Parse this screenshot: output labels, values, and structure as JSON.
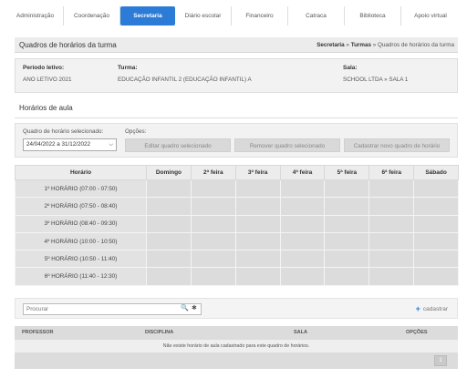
{
  "nav": {
    "items": [
      {
        "label": "Administração",
        "active": false
      },
      {
        "label": "Coordenação",
        "active": false
      },
      {
        "label": "Secretaria",
        "active": true
      },
      {
        "label": "Diário escolar",
        "active": false
      },
      {
        "label": "Financeiro",
        "active": false
      },
      {
        "label": "Catraca",
        "active": false
      },
      {
        "label": "Biblioteca",
        "active": false
      },
      {
        "label": "Apoio virtual",
        "active": false
      }
    ]
  },
  "header": {
    "title": "Quadros de horários da turma",
    "breadcrumb": {
      "secretaria": "Secretaria",
      "sep1": " » ",
      "turmas": "Turmas",
      "sep2": " » ",
      "current": "Quadros de horários da turma"
    }
  },
  "info": {
    "periodo_label": "Período letivo:",
    "periodo_value": "ANO LETIVO 2021",
    "turma_label": "Turma:",
    "turma_value": "EDUCAÇÃO INFANTIL 2 (EDUCAÇÃO INFANTIL) A",
    "sala_label": "Sala:",
    "sala_value": "SCHOOL LTDA » SALA 1"
  },
  "section": {
    "title": "Horários de aula"
  },
  "selector": {
    "label": "Quadro de horário selecionado:",
    "value": "24/04/2022 a 31/12/2022",
    "opcoes_label": "Opções:",
    "btn_edit": "Editar quadro selecionado",
    "btn_remove": "Remover quadro selecionado",
    "btn_new": "Cadastrar novo quadro de horário"
  },
  "grid": {
    "headers": [
      "Horário",
      "Domingo",
      "2ª feira",
      "3ª feira",
      "4ª feira",
      "5ª feira",
      "6ª feira",
      "Sábado"
    ],
    "rows": [
      "1º HORÁRIO (07:00 - 07:50)",
      "2º HORÁRIO (07:50 - 08:40)",
      "3º HORÁRIO (08:40 - 09:30)",
      "4º HORÁRIO (10:00 - 10:50)",
      "5º HORÁRIO (10:50 - 11:40)",
      "6º HORÁRIO (11:40 - 12:30)"
    ]
  },
  "search": {
    "placeholder": "Procurar",
    "search_icon": "🔍",
    "clear_icon": "✱",
    "add_label": "cadastrar",
    "add_icon": "+"
  },
  "list": {
    "headers": {
      "professor": "PROFESSOR",
      "disciplina": "DISCIPLINA",
      "sala": "SALA",
      "opcoes": "OPÇÕES"
    },
    "empty_message": "Não existe horário de aula cadastrado para este quadro de horários.",
    "page": "1"
  },
  "colors": {
    "accent": "#2c7bd6",
    "panel": "#f2f2f2",
    "cell": "#dcdcdc"
  }
}
